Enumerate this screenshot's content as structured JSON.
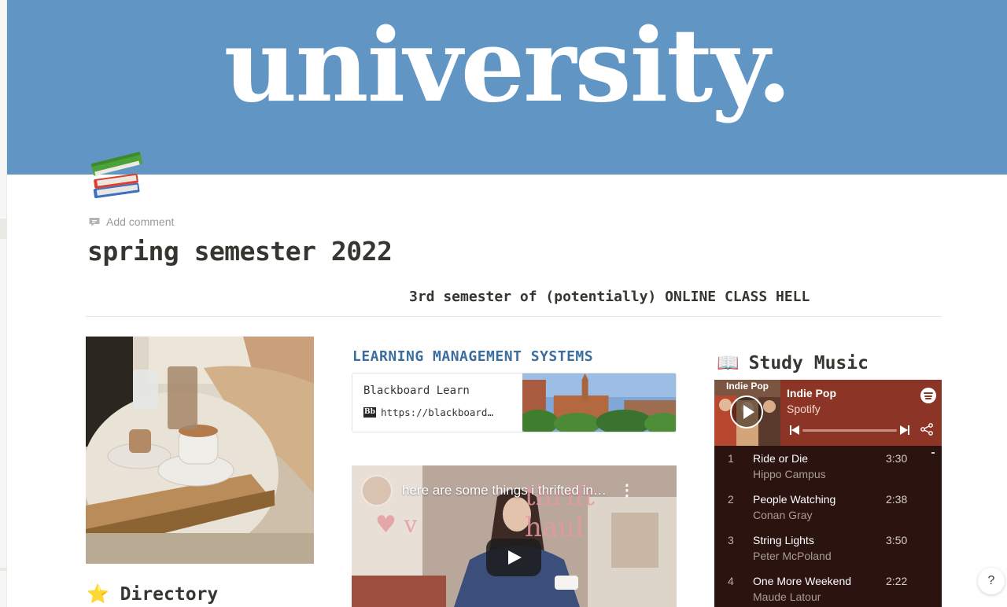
{
  "cover": {
    "title": "university."
  },
  "page": {
    "add_comment": "Add comment",
    "title": "spring semester 2022",
    "subtitle": "3rd semester of (potentially) ONLINE CLASS HELL"
  },
  "directory": {
    "icon": "⭐",
    "heading": "Directory"
  },
  "lms": {
    "heading": "LEARNING MANAGEMENT SYSTEMS",
    "bookmark": {
      "title": "Blackboard Learn",
      "url": "https://blackboard…",
      "favicon": "Bb"
    }
  },
  "video": {
    "title": "here are some things i thrifted in…",
    "menu": "⋮"
  },
  "study_music": {
    "icon": "📖",
    "heading": "Study Music",
    "spotify": {
      "cover_label": "Indie Pop",
      "playlist": "Indie Pop",
      "source": "Spotify",
      "progress": 0,
      "tracks": [
        {
          "num": "1",
          "name": "Ride or Die",
          "artist": "Hippo Campus",
          "duration": "3:30"
        },
        {
          "num": "2",
          "name": "People Watching",
          "artist": "Conan Gray",
          "duration": "2:38"
        },
        {
          "num": "3",
          "name": "String Lights",
          "artist": "Peter McPoland",
          "duration": "3:50"
        },
        {
          "num": "4",
          "name": "One More Weekend",
          "artist": "Maude Latour",
          "duration": "2:22"
        }
      ]
    }
  },
  "help": {
    "label": "?"
  },
  "colors": {
    "cover": "#6196c4",
    "lms_heading": "#3b6e9e",
    "spotify_header": "#8c3527",
    "spotify_body": "#2b1310"
  }
}
